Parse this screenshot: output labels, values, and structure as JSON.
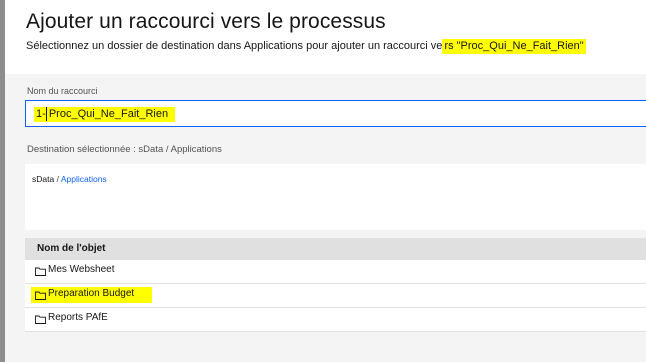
{
  "dialog": {
    "title": "Ajouter un raccourci vers le processus",
    "subtitle_prefix": "Sélectionnez un dossier de destination dans Applications pour ajouter un raccourci ve",
    "subtitle_highlight": "rs \"Proc_Qui_Ne_Fait_Rien\""
  },
  "shortcut": {
    "label": "Nom du raccourci",
    "value": "1- Proc_Qui_Ne_Fait_Rien"
  },
  "destination": {
    "label": "Destination sélectionnée : sData / Applications",
    "breadcrumb": {
      "root": "sData",
      "separator": " / ",
      "current": "Applications"
    }
  },
  "table": {
    "header": "Nom de l'objet",
    "rows": [
      {
        "name": "Mes Websheet",
        "icon": "folder-icon",
        "highlighted": false
      },
      {
        "name": "Preparation Budget",
        "icon": "folder-icon",
        "highlighted": true
      },
      {
        "name": "Reports PAfE",
        "icon": "folder-icon",
        "highlighted": false
      }
    ]
  },
  "colors": {
    "highlight": "#ffff00",
    "link": "#0f62fe",
    "panel": "#f4f4f4",
    "header_row": "#e0e0e0"
  }
}
